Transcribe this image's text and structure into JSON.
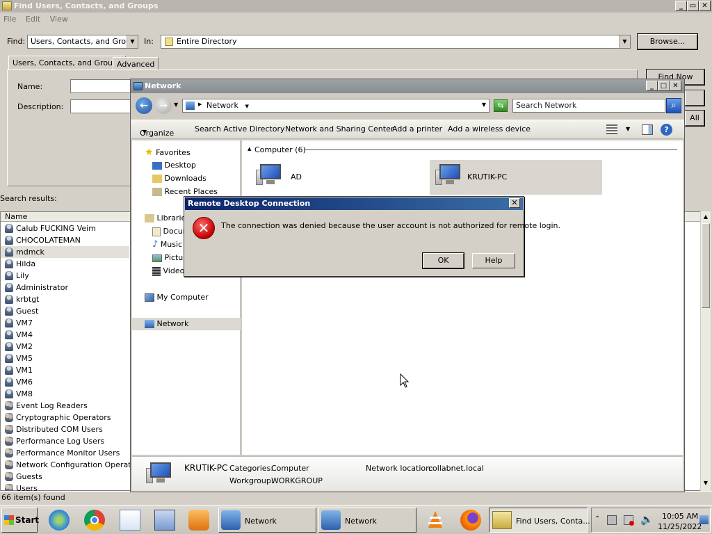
{
  "find_window": {
    "title": "Find Users, Contacts, and Groups",
    "menu": [
      "File",
      "Edit",
      "View"
    ],
    "find_label": "Find:",
    "find_value": "Users, Contacts, and Groups",
    "in_label": "In:",
    "in_value": "Entire Directory",
    "browse_label": "Browse...",
    "tabs": [
      "Users, Contacts, and Groups",
      "Advanced"
    ],
    "name_label": "Name:",
    "description_label": "Description:",
    "find_now_label": "Find Now",
    "clear_all_label": "All",
    "search_results_label": "Search results:",
    "column_name": "Name",
    "results": [
      {
        "name": "Calub FUCKING Veim",
        "type": "user"
      },
      {
        "name": "CHOCOLATEMAN",
        "type": "user"
      },
      {
        "name": "mdmck",
        "type": "user"
      },
      {
        "name": "Hilda",
        "type": "user"
      },
      {
        "name": "Lily",
        "type": "user"
      },
      {
        "name": "Administrator",
        "type": "user"
      },
      {
        "name": "krbtgt",
        "type": "user"
      },
      {
        "name": "Guest",
        "type": "user"
      },
      {
        "name": "VM7",
        "type": "user"
      },
      {
        "name": "VM4",
        "type": "user"
      },
      {
        "name": "VM2",
        "type": "user"
      },
      {
        "name": "VM5",
        "type": "user"
      },
      {
        "name": "VM1",
        "type": "user"
      },
      {
        "name": "VM6",
        "type": "user"
      },
      {
        "name": "VM8",
        "type": "user"
      },
      {
        "name": "Event Log Readers",
        "type": "group"
      },
      {
        "name": "Cryptographic Operators",
        "type": "group"
      },
      {
        "name": "Distributed COM Users",
        "type": "group"
      },
      {
        "name": "Performance Log Users",
        "type": "group"
      },
      {
        "name": "Performance Monitor Users",
        "type": "group"
      },
      {
        "name": "Network Configuration Operators",
        "type": "group"
      },
      {
        "name": "Guests",
        "type": "group"
      },
      {
        "name": "Users",
        "type": "group"
      }
    ],
    "status": "66 item(s) found"
  },
  "network_window": {
    "title": "Network",
    "breadcrumb": "Network",
    "search_placeholder": "Search Network",
    "commands": [
      "Organize",
      "Search Active Directory",
      "Network and Sharing Center",
      "Add a printer",
      "Add a wireless device"
    ],
    "nav": {
      "favorites": "Favorites",
      "desktop": "Desktop",
      "downloads": "Downloads",
      "recent": "Recent Places",
      "libraries": "Libraries",
      "documents": "Documents",
      "music": "Music",
      "pictures": "Pictures",
      "videos": "Videos",
      "my_computer": "My Computer",
      "network": "Network"
    },
    "group_header": "Computer (6)",
    "computers": [
      "AD",
      "KRUTIK-PC"
    ],
    "details": {
      "name": "KRUTIK-PC",
      "categories_label": "Categories:",
      "categories_value": "Computer",
      "workgroup_label": "Workgroup:",
      "workgroup_value": "WORKGROUP",
      "location_label": "Network location:",
      "location_value": "collabnet.local"
    }
  },
  "dialog": {
    "title": "Remote Desktop Connection",
    "message": "The connection was denied because the user account is not authorized for remote login.",
    "ok_label": "OK",
    "help_label": "Help",
    "close_glyph": "✕"
  },
  "taskbar": {
    "start_label": "Start",
    "tasks": [
      "Network",
      "Network",
      "Find Users, Conta..."
    ],
    "time": "10:05 AM",
    "date": "11/25/2022"
  }
}
